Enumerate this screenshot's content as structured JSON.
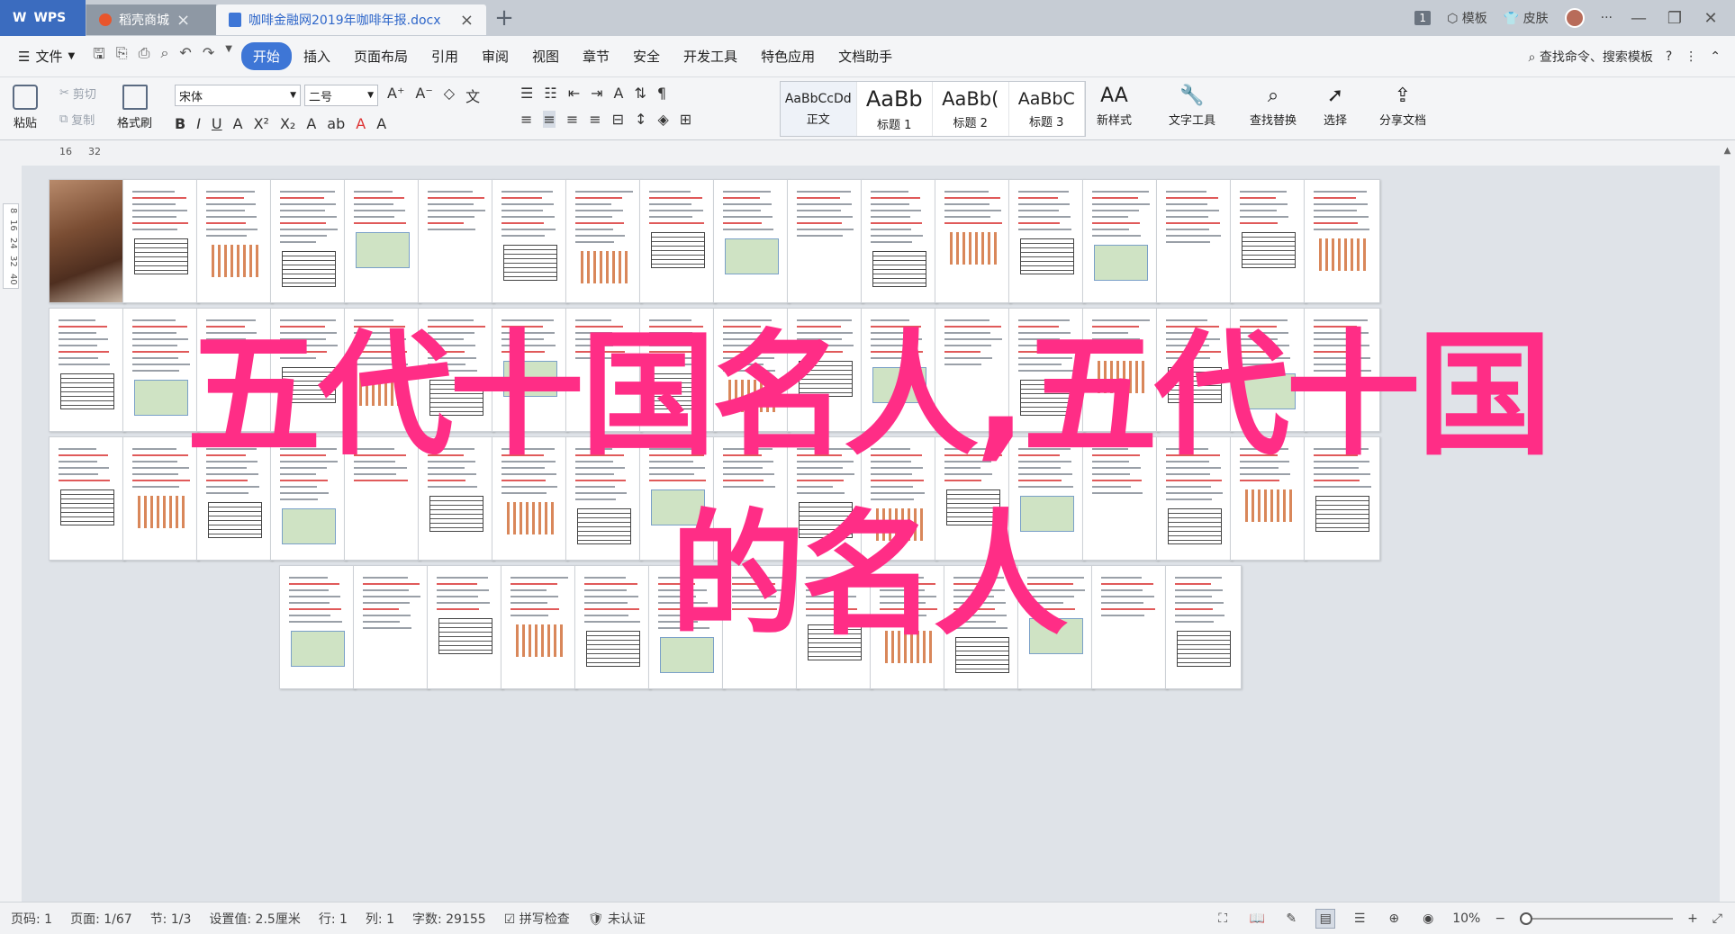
{
  "titlebar": {
    "wps_label": "WPS",
    "tabs": [
      {
        "label": "稻壳商城"
      },
      {
        "label": "咖啡金融网2019年咖啡年报.docx"
      }
    ],
    "page_badge": "1",
    "template_label": "模板",
    "skin_label": "皮肤"
  },
  "menubar": {
    "file_label": "文件",
    "items": [
      "开始",
      "插入",
      "页面布局",
      "引用",
      "审阅",
      "视图",
      "章节",
      "安全",
      "开发工具",
      "特色应用",
      "文档助手"
    ],
    "active": "开始",
    "search_placeholder": "查找命令、搜索模板"
  },
  "ribbon": {
    "paste": "粘贴",
    "cut": "剪切",
    "copy": "复制",
    "format_painter": "格式刷",
    "font_name": "宋体",
    "font_size": "二号",
    "styles": [
      {
        "sample": "AaBbCcDd",
        "name": "正文"
      },
      {
        "sample": "AaBb",
        "name": "标题 1"
      },
      {
        "sample": "AaBb(",
        "name": "标题 2"
      },
      {
        "sample": "AaBbC",
        "name": "标题 3"
      }
    ],
    "new_style": "新样式",
    "text_tools": "文字工具",
    "find_replace": "查找替换",
    "select": "选择",
    "share": "分享文档"
  },
  "ruler": {
    "top_marks": [
      "16",
      "32"
    ],
    "left_marks": [
      "8",
      "16",
      "24",
      "32",
      "40"
    ]
  },
  "overlay": {
    "line1": "五代十国名人,五代十国",
    "line2": "的名人"
  },
  "statusbar": {
    "page_num": "页码: 1",
    "pages": "页面: 1/67",
    "section": "节: 1/3",
    "setting": "设置值: 2.5厘米",
    "row": "行: 1",
    "col": "列: 1",
    "word_count": "字数: 29155",
    "spell_check": "拼写检查",
    "auth": "未认证",
    "zoom": "10%"
  },
  "colors": {
    "accent": "#3e76d6",
    "overlay": "#ff2d86"
  }
}
